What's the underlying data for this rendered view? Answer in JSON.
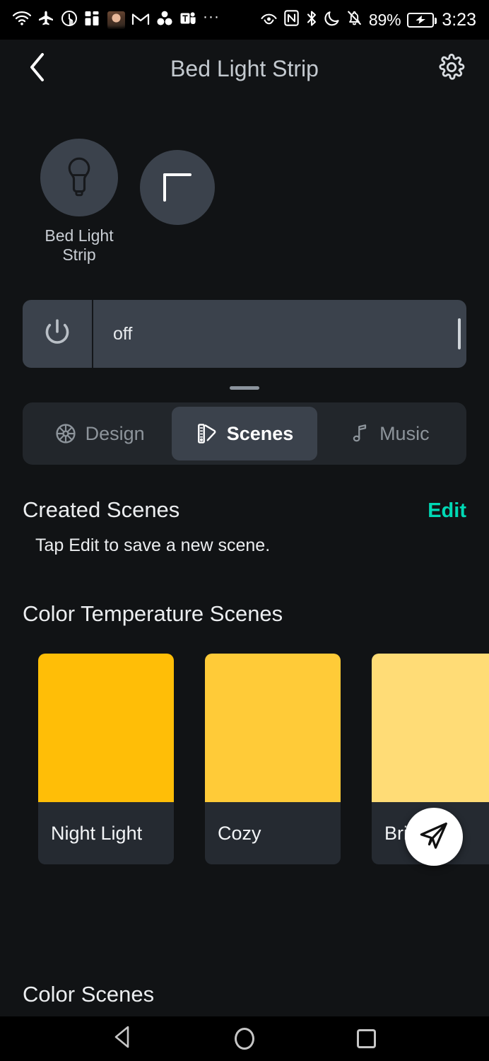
{
  "status_bar": {
    "left_icons": [
      "wifi-icon",
      "airplane-mode-icon",
      "screen-timer-icon",
      "app-notification-icon",
      "avatar-notification-icon",
      "gmail-icon",
      "google-drive-icon",
      "microsoft-teams-icon",
      "more-notifications-icon"
    ],
    "right_icons": [
      "eye-comfort-icon",
      "nfc-icon",
      "bluetooth-icon",
      "do-not-disturb-icon",
      "ringer-muted-icon"
    ],
    "battery_percent": "89%",
    "battery_state": "charging",
    "time": "3:23"
  },
  "app_bar": {
    "back_icon": "chevron-left-icon",
    "title": "Bed Light Strip",
    "settings_icon": "gear-icon"
  },
  "devices": {
    "items": [
      {
        "icon": "light-bulb-icon",
        "label": "Bed Light Strip"
      }
    ],
    "add_label": "+",
    "add_icon": "plus-icon"
  },
  "power_bar": {
    "power_icon": "power-icon",
    "state_label": "off",
    "brightness_handle": "slider-handle"
  },
  "tabs": [
    {
      "label": "Design",
      "icon": "color-wheel-icon",
      "active": false
    },
    {
      "label": "Scenes",
      "icon": "palette-swatch-icon",
      "active": true
    },
    {
      "label": "Music",
      "icon": "music-note-icon",
      "active": false
    }
  ],
  "created_scenes": {
    "title": "Created Scenes",
    "edit_label": "Edit",
    "edit_color": "#00d9b5",
    "empty_hint": "Tap Edit to save a new scene."
  },
  "color_temperature_scenes": {
    "title": "Color Temperature Scenes",
    "cards": [
      {
        "name": "Night Light",
        "color": "#ffbe07"
      },
      {
        "name": "Cozy",
        "color": "#ffcb38"
      },
      {
        "name": "Bright",
        "color": "#ffdc76"
      }
    ]
  },
  "color_scenes": {
    "title": "Color Scenes"
  },
  "fab": {
    "icon": "send-icon"
  },
  "nav_bar": {
    "back_icon": "triangle-back-icon",
    "home_icon": "circle-home-icon",
    "recents_icon": "square-recents-icon"
  },
  "theme": {
    "background": "#111315",
    "surface": "#3b424c",
    "tab_container": "#22262b",
    "card_footer": "#252a31",
    "accent": "#00d9b5",
    "text_primary": "#eceef0",
    "text_secondary": "#8d949b"
  }
}
